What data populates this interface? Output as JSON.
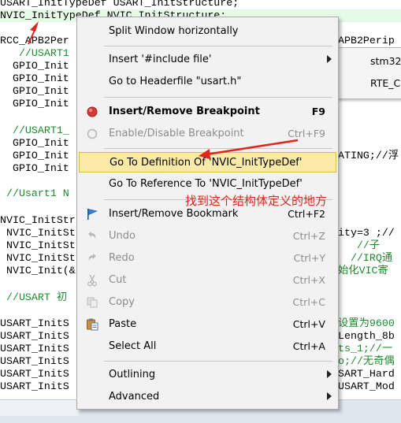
{
  "code": {
    "lines": [
      "USART_InitTypeDef USART_InitStructure;",
      "NVIC_InitTypeDef NVIC_InitStructure;",
      "",
      "RCC_APB2Per",
      "   //USART1",
      "  GPIO_Init",
      "  GPIO_Init",
      "  GPIO_Init",
      "  GPIO_Init",
      "",
      "  //USART1_",
      "  GPIO_Init",
      "  GPIO_Init",
      "  GPIO_Init",
      "",
      " //Usart1 N",
      "",
      "NVIC_InitStr",
      " NVIC_InitSt",
      " NVIC_InitSt",
      " NVIC_InitSt",
      " NVIC_Init(&",
      "",
      " //USART 初",
      "",
      "USART_InitS",
      "USART_InitS",
      "USART_InitS",
      "USART_InitS",
      "USART_InitS",
      "USART_InitS"
    ],
    "right_lines": [
      "APB2Perip",
      "",
      "",
      "",
      "",
      "",
      "",
      "",
      "",
      "",
      "",
      "",
      "ATING;//浮",
      "",
      "",
      "",
      "",
      "ity=3 ;//",
      "   //子",
      "  //IRQ通",
      "始化VIC寄",
      "",
      "",
      "",
      "",
      "设置为9600",
      "Length_8b",
      "ts_1;//一",
      "o;//无奇偶",
      "SART_Hard",
      "USART_Mod"
    ]
  },
  "submenu": {
    "items": [
      "stm32f",
      "RTE_Co"
    ]
  },
  "menu": {
    "items": [
      {
        "label": "Split Window horizontally",
        "shortcut": "",
        "icon": "",
        "disabled": false,
        "bold": false,
        "submenu": false
      },
      {
        "label": "Insert '#include file'",
        "shortcut": "",
        "icon": "",
        "disabled": false,
        "bold": false,
        "submenu": true
      },
      {
        "label": "Go to Headerfile \"usart.h\"",
        "shortcut": "",
        "icon": "",
        "disabled": false,
        "bold": false,
        "submenu": false
      },
      {
        "label": "Insert/Remove Breakpoint",
        "shortcut": "F9",
        "icon": "breakpoint-icon",
        "disabled": false,
        "bold": true,
        "submenu": false
      },
      {
        "label": "Enable/Disable Breakpoint",
        "shortcut": "Ctrl+F9",
        "icon": "breakpoint-disabled-icon",
        "disabled": true,
        "bold": false,
        "submenu": false
      },
      {
        "label": "Go To Definition Of 'NVIC_InitTypeDef'",
        "shortcut": "",
        "icon": "",
        "disabled": false,
        "bold": false,
        "submenu": false,
        "selected": true
      },
      {
        "label": "Go To Reference To 'NVIC_InitTypeDef'",
        "shortcut": "",
        "icon": "",
        "disabled": false,
        "bold": false,
        "submenu": false
      },
      {
        "label": "Insert/Remove Bookmark",
        "shortcut": "Ctrl+F2",
        "icon": "bookmark-flag-icon",
        "disabled": false,
        "bold": false,
        "submenu": false
      },
      {
        "label": "Undo",
        "shortcut": "Ctrl+Z",
        "icon": "undo-icon",
        "disabled": true,
        "bold": false,
        "submenu": false
      },
      {
        "label": "Redo",
        "shortcut": "Ctrl+Y",
        "icon": "redo-icon",
        "disabled": true,
        "bold": false,
        "submenu": false
      },
      {
        "label": "Cut",
        "shortcut": "Ctrl+X",
        "icon": "scissors-icon",
        "disabled": true,
        "bold": false,
        "submenu": false
      },
      {
        "label": "Copy",
        "shortcut": "Ctrl+C",
        "icon": "copy-icon",
        "disabled": true,
        "bold": false,
        "submenu": false
      },
      {
        "label": "Paste",
        "shortcut": "Ctrl+V",
        "icon": "paste-icon",
        "disabled": false,
        "bold": false,
        "submenu": false
      },
      {
        "label": "Select All",
        "shortcut": "Ctrl+A",
        "icon": "",
        "disabled": false,
        "bold": false,
        "submenu": false
      },
      {
        "label": "Outlining",
        "shortcut": "",
        "icon": "",
        "disabled": false,
        "bold": false,
        "submenu": true
      },
      {
        "label": "Advanced",
        "shortcut": "",
        "icon": "",
        "disabled": false,
        "bold": false,
        "submenu": true
      }
    ]
  },
  "annotation": {
    "text": "找到这个结构体定义的地方"
  },
  "colors": {
    "annotation": "#e1251b",
    "selection_bg": "#fbe9a8",
    "comment": "#1e8a2e",
    "breakpoint": "#d63b3b"
  }
}
